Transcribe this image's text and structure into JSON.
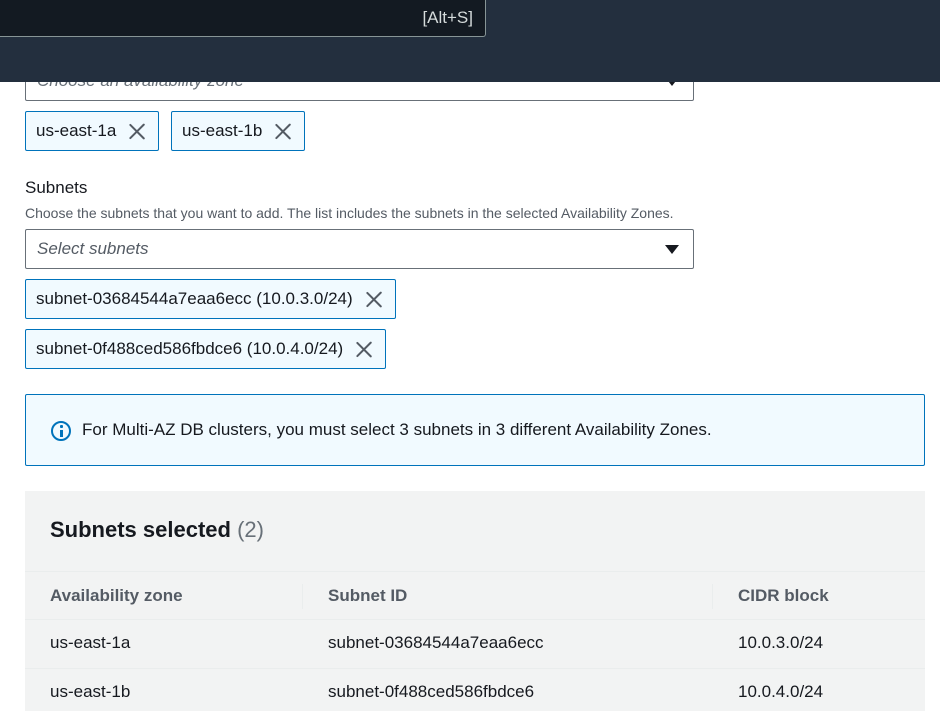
{
  "topbar": {
    "search_shortcut": "[Alt+S]"
  },
  "availability_zones": {
    "placeholder": "Choose an availability zone",
    "selected": [
      "us-east-1a",
      "us-east-1b"
    ]
  },
  "subnets": {
    "label": "Subnets",
    "description": "Choose the subnets that you want to add. The list includes the subnets in the selected Availability Zones.",
    "placeholder": "Select subnets",
    "selected": [
      "subnet-03684544a7eaa6ecc (10.0.3.0/24)",
      "subnet-0f488ced586fbdce6 (10.0.4.0/24)"
    ]
  },
  "alert": {
    "message": "For Multi-AZ DB clusters, you must select 3 subnets in 3 different Availability Zones."
  },
  "selected_panel": {
    "title": "Subnets selected",
    "count": "(2)",
    "columns": [
      "Availability zone",
      "Subnet ID",
      "CIDR block"
    ],
    "rows": [
      [
        "us-east-1a",
        "subnet-03684544a7eaa6ecc",
        "10.0.3.0/24"
      ],
      [
        "us-east-1b",
        "subnet-0f488ced586fbdce6",
        "10.0.4.0/24"
      ]
    ]
  }
}
